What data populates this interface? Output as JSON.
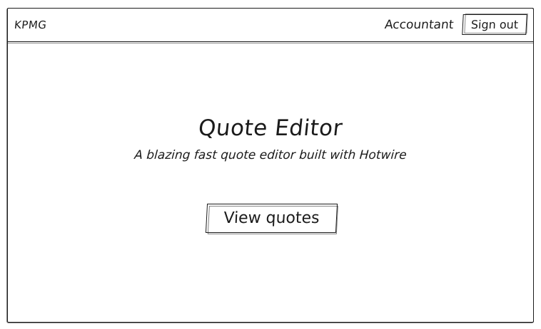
{
  "navbar": {
    "brand": "KPMG",
    "role": "Accountant",
    "signout_label": "Sign out"
  },
  "hero": {
    "title": "Quote Editor",
    "subtitle": "A blazing fast quote editor built with Hotwire",
    "cta_label": "View quotes"
  },
  "colors": {
    "ink": "#1b1b1b",
    "background": "#ffffff"
  }
}
